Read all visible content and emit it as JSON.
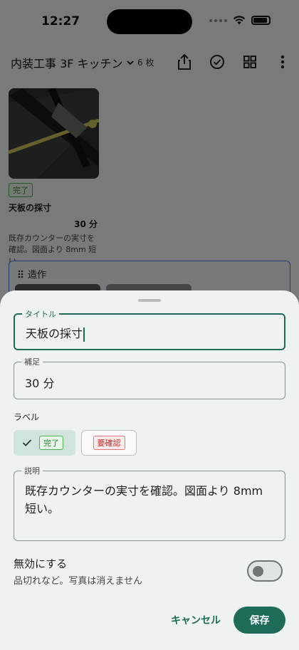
{
  "status_bar": {
    "time": "12:27"
  },
  "app_bar": {
    "album_title": "内装工事 3F キッチン",
    "photo_count": "6 枚",
    "icons": [
      "share-icon",
      "check-circle-icon",
      "grid-icon",
      "more-vert-icon"
    ]
  },
  "photo_card": {
    "badge": "完了",
    "title": "天板の採寸",
    "duration": "30 分",
    "description": "既存カウンターの実寸を確認。図面より 8mm 短い。"
  },
  "section": {
    "title": "造作"
  },
  "sheet": {
    "title_field": {
      "label": "タイトル",
      "value": "天板の採寸"
    },
    "note_field": {
      "label": "補足",
      "value": "30 分"
    },
    "labels_heading": "ラベル",
    "labels": [
      {
        "text": "完了",
        "selected": true,
        "color": "#2e7d32"
      },
      {
        "text": "要確認",
        "selected": false,
        "color": "#c62828"
      }
    ],
    "description_field": {
      "label": "説明",
      "value": "既存カウンターの実寸を確認。図面より 8mm 短い。"
    },
    "disable_toggle": {
      "title": "無効にする",
      "subtitle": "品切れなど。写真は消えません",
      "on": false
    },
    "cancel_label": "キャンセル",
    "save_label": "保存"
  },
  "colors": {
    "accent": "#1e6b58",
    "chip_selected_bg": "#cfe4dc",
    "sheet_bg": "#eef3f1"
  }
}
